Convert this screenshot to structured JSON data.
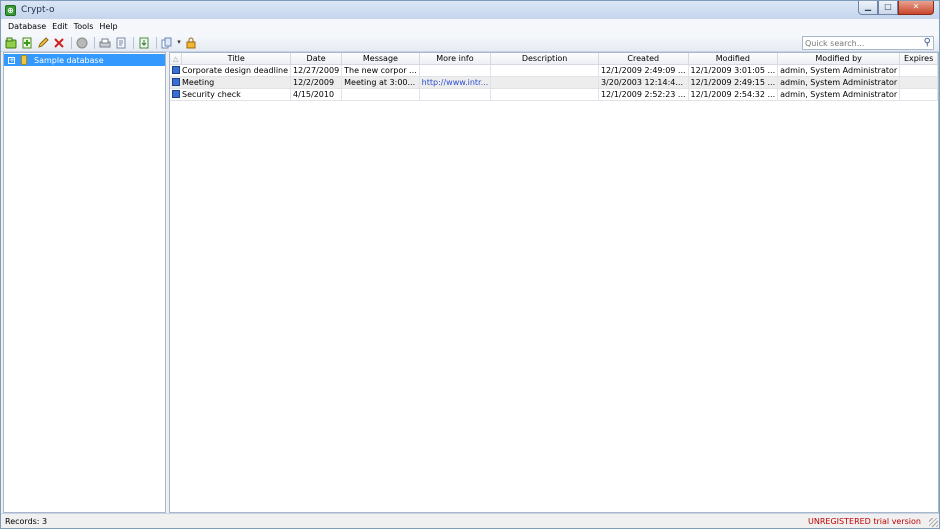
{
  "window": {
    "title": "Crypt-o",
    "icon": "app-lock-icon"
  },
  "menu": [
    "Database",
    "Edit",
    "Tools",
    "Help"
  ],
  "toolbar": {
    "buttons": [
      "new-database-icon",
      "add-record-icon",
      "edit-record-icon",
      "delete-record-icon",
      "disabled-icon",
      "print-icon",
      "export-icon",
      "import-icon",
      "copy-icon",
      "lock-icon"
    ]
  },
  "search": {
    "placeholder": "Quick search..."
  },
  "tree": {
    "root_label": "Sample database",
    "expander": "+"
  },
  "grid": {
    "columns": [
      "",
      "Title",
      "Date",
      "Message",
      "More info",
      "Description",
      "Created",
      "Modified",
      "Modified by",
      "Expires"
    ],
    "rows": [
      {
        "title": "Corporate design deadline",
        "date": "12/27/2009",
        "message": "The new corpor ...",
        "more_info": "",
        "description": "",
        "created": "12/1/2009 2:49:09 ...",
        "modified": "12/1/2009 3:01:05 ...",
        "modified_by": "admin, System Administrator",
        "expires": ""
      },
      {
        "title": "Meeting",
        "date": "12/2/2009",
        "message": "Meeting at 3:00...",
        "more_info": "http://www.intr...",
        "description": "",
        "created": "3/20/2003 12:14:4...",
        "modified": "12/1/2009 2:49:15 ...",
        "modified_by": "admin, System Administrator",
        "expires": ""
      },
      {
        "title": "Security check",
        "date": "4/15/2010",
        "message": "",
        "more_info": "",
        "description": "",
        "created": "12/1/2009 2:52:23 ...",
        "modified": "12/1/2009 2:54:32 ...",
        "modified_by": "admin, System Administrator",
        "expires": ""
      }
    ]
  },
  "status": {
    "records": "Records: 3",
    "registration": "UNREGISTERED trial version"
  }
}
